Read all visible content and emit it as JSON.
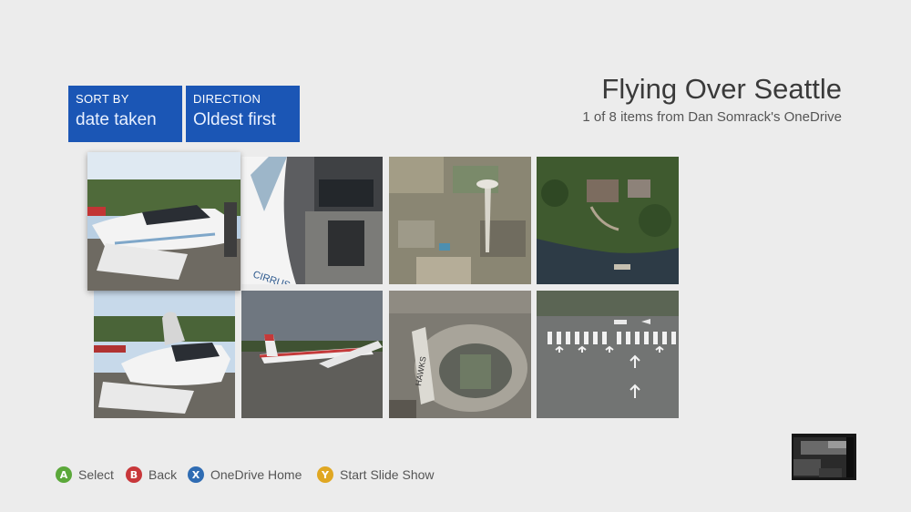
{
  "sort": {
    "label": "SORT BY",
    "value": "date taken"
  },
  "direction": {
    "label": "DIRECTION",
    "value": "Oldest first"
  },
  "album": {
    "title": "Flying Over Seattle",
    "subtitle": "1 of 8 items from Dan Somrack's OneDrive"
  },
  "photos": [
    {
      "name": "airplane-cockpit-boarding-photo",
      "selected": true
    },
    {
      "name": "cirrus-cockpit-interior-photo"
    },
    {
      "name": "space-needle-aerial-photo"
    },
    {
      "name": "lakeside-house-aerial-photo"
    },
    {
      "name": "cirrus-open-canopy-photo"
    },
    {
      "name": "cessna-on-tarmac-photo"
    },
    {
      "name": "stadium-aerial-photo"
    },
    {
      "name": "runway-threshold-photo"
    }
  ],
  "hints": [
    {
      "key": "A",
      "label": "Select",
      "color": "#5ba83a"
    },
    {
      "key": "B",
      "label": "Back",
      "color": "#c8373a"
    },
    {
      "key": "X",
      "label": "OneDrive Home",
      "color": "#2f6cb3"
    },
    {
      "key": "Y",
      "label": "Start Slide Show",
      "color": "#e0a722"
    }
  ],
  "colors": {
    "tile": "#1b56b5",
    "background": "#ececec"
  }
}
